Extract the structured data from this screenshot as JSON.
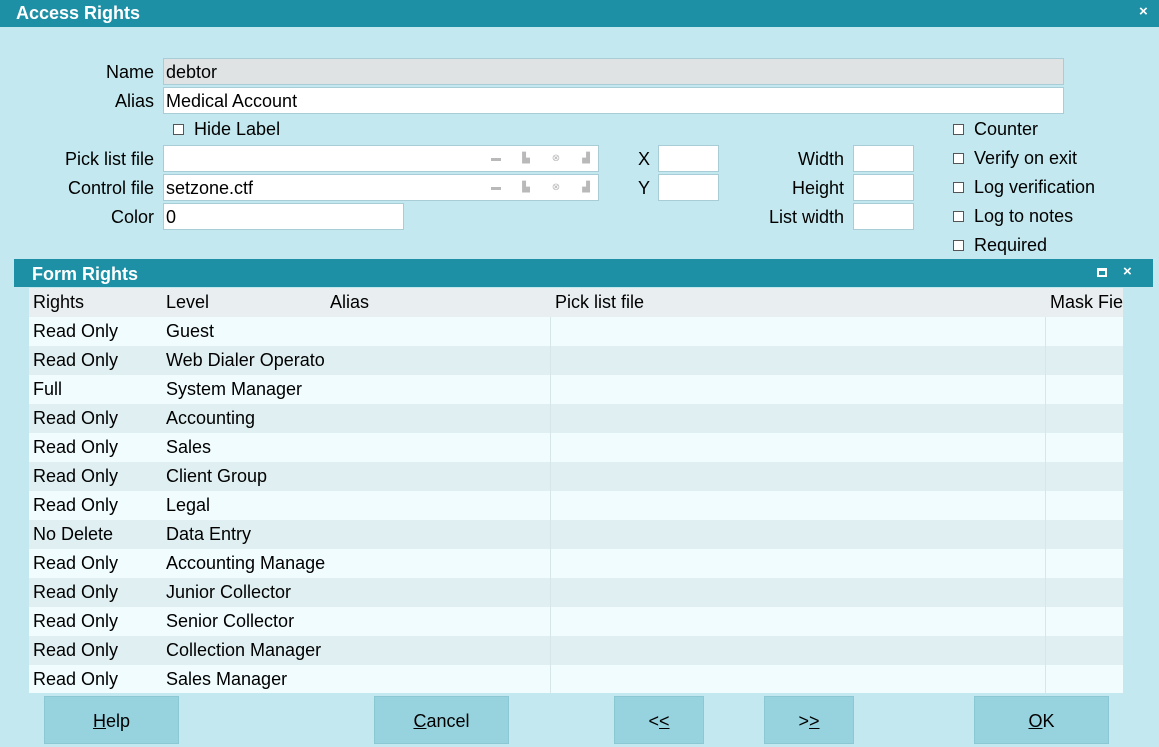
{
  "window": {
    "title": "Access Rights",
    "close": "×"
  },
  "form": {
    "name_label": "Name",
    "name_value": "debtor",
    "alias_label": "Alias",
    "alias_value": "Medical Account",
    "hide_label": "Hide Label",
    "pick_list_label": "Pick list file",
    "pick_list_value": "",
    "control_file_label": "Control file",
    "control_file_value": "setzone.ctf",
    "color_label": "Color",
    "color_value": "0",
    "x_label": "X",
    "y_label": "Y",
    "width_label": "Width",
    "height_label": "Height",
    "list_width_label": "List width",
    "checkboxes": [
      "Counter",
      "Verify on exit",
      "Log verification",
      "Log to notes",
      "Required"
    ]
  },
  "form_rights": {
    "title": "Form Rights",
    "close": "×",
    "columns": [
      "Rights",
      "Level",
      "Alias",
      "Pick list file",
      "Mask Fie"
    ],
    "rows": [
      [
        "Read Only",
        "Guest"
      ],
      [
        "Read Only",
        "Web Dialer Operato"
      ],
      [
        "Full",
        "System Manager"
      ],
      [
        "Read Only",
        "Accounting"
      ],
      [
        "Read Only",
        "Sales"
      ],
      [
        "Read Only",
        "Client Group"
      ],
      [
        "Read Only",
        "Legal"
      ],
      [
        "No Delete",
        "Data Entry"
      ],
      [
        "Read Only",
        "Accounting Manage"
      ],
      [
        "Read Only",
        "Junior Collector"
      ],
      [
        "Read Only",
        "Senior Collector"
      ],
      [
        "Read Only",
        "Collection Manager"
      ],
      [
        "Read Only",
        "Sales Manager"
      ]
    ]
  },
  "buttons": {
    "help": {
      "mnemonic": "H",
      "rest": "elp"
    },
    "cancel": {
      "mnemonic": "C",
      "rest": "ancel"
    },
    "prev": {
      "first": "<",
      "mnemonic": "<"
    },
    "next": {
      "first": ">",
      "mnemonic": ">"
    },
    "ok": {
      "mnemonic": "O",
      "rest": "K"
    }
  },
  "icons": [
    "folder-icon",
    "print-icon",
    "clear-icon",
    "lookup-icon"
  ],
  "colors": {
    "accent": "#1e90a5",
    "background": "#c3e8ef",
    "button": "#96d3df"
  }
}
